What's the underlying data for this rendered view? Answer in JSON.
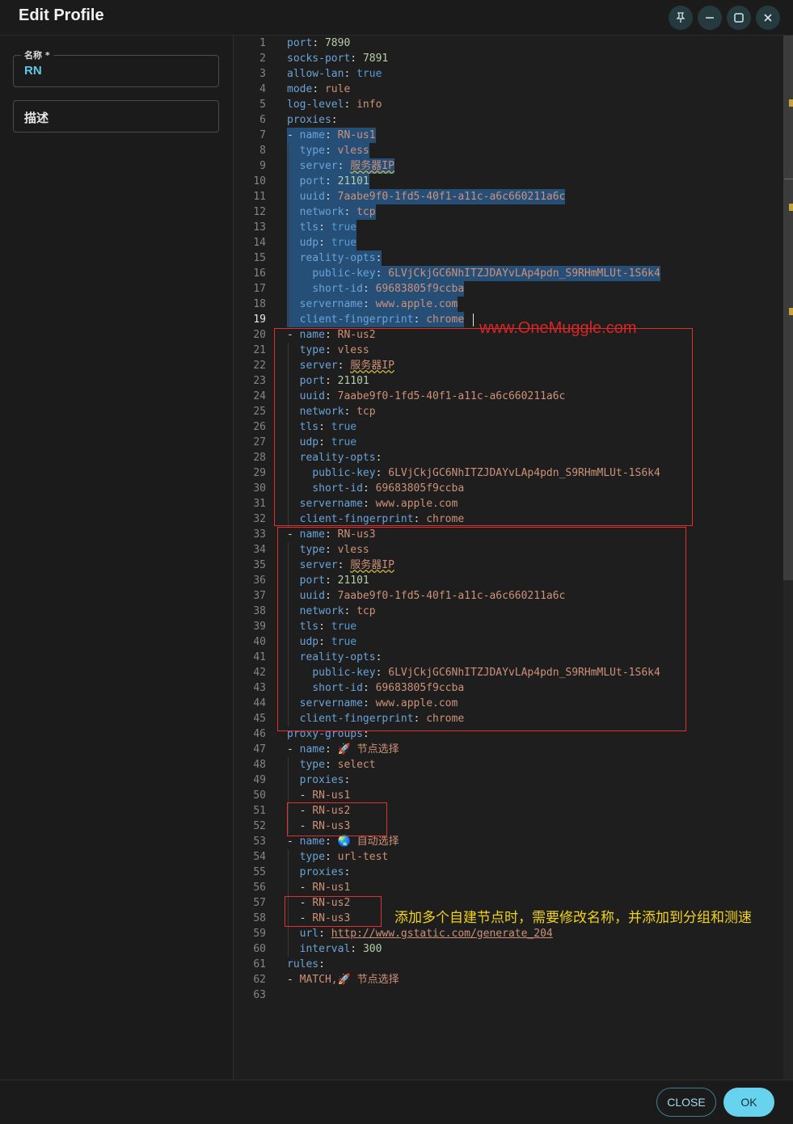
{
  "window": {
    "title": "Edit Profile",
    "controls": [
      "pin-icon",
      "minimize-icon",
      "maximize-icon",
      "close-icon"
    ]
  },
  "form": {
    "name_label": "名称 *",
    "name_value": "RN",
    "description_placeholder": "描述"
  },
  "editor": {
    "current_line": 19,
    "lines": [
      "port: 7890",
      "socks-port: 7891",
      "allow-lan: true",
      "mode: rule",
      "log-level: info",
      "proxies:",
      "- name: RN-us1",
      "  type: vless",
      "  server: 服务器IP",
      "  port: 21101",
      "  uuid: 7aabe9f0-1fd5-40f1-a11c-a6c660211a6c",
      "  network: tcp",
      "  tls: true",
      "  udp: true",
      "  reality-opts:",
      "    public-key: 6LVjCkjGC6NhITZJDAYvLAp4pdn_S9RHmMLUt-1S6k4",
      "    short-id: 69683805f9ccba",
      "  servername: www.apple.com",
      "  client-fingerprint: chrome",
      "- name: RN-us2",
      "  type: vless",
      "  server: 服务器IP",
      "  port: 21101",
      "  uuid: 7aabe9f0-1fd5-40f1-a11c-a6c660211a6c",
      "  network: tcp",
      "  tls: true",
      "  udp: true",
      "  reality-opts:",
      "    public-key: 6LVjCkjGC6NhITZJDAYvLAp4pdn_S9RHmMLUt-1S6k4",
      "    short-id: 69683805f9ccba",
      "  servername: www.apple.com",
      "  client-fingerprint: chrome",
      "- name: RN-us3",
      "  type: vless",
      "  server: 服务器IP",
      "  port: 21101",
      "  uuid: 7aabe9f0-1fd5-40f1-a11c-a6c660211a6c",
      "  network: tcp",
      "  tls: true",
      "  udp: true",
      "  reality-opts:",
      "    public-key: 6LVjCkjGC6NhITZJDAYvLAp4pdn_S9RHmMLUt-1S6k4",
      "    short-id: 69683805f9ccba",
      "  servername: www.apple.com",
      "  client-fingerprint: chrome",
      "proxy-groups:",
      "- name: 🚀 节点选择",
      "  type: select",
      "  proxies:",
      "  - RN-us1",
      "  - RN-us2",
      "  - RN-us3",
      "- name: 🌏 自动选择",
      "  type: url-test",
      "  proxies:",
      "  - RN-us1",
      "  - RN-us2",
      "  - RN-us3",
      "  url: http://www.gstatic.com/generate_204",
      "  interval: 300",
      "rules:",
      "- MATCH,🚀 节点选择",
      ""
    ]
  },
  "annotations": {
    "watermark": "www.OneMuggle.com",
    "note": "添加多个自建节点时，需要修改名称，并添加到分组和测速"
  },
  "footer": {
    "close_label": "CLOSE",
    "ok_label": "OK"
  },
  "colors": {
    "accent": "#67d3ee",
    "annotation_red": "#e03131",
    "annotation_yellow": "#f2d21b",
    "selection": "#264f78"
  }
}
